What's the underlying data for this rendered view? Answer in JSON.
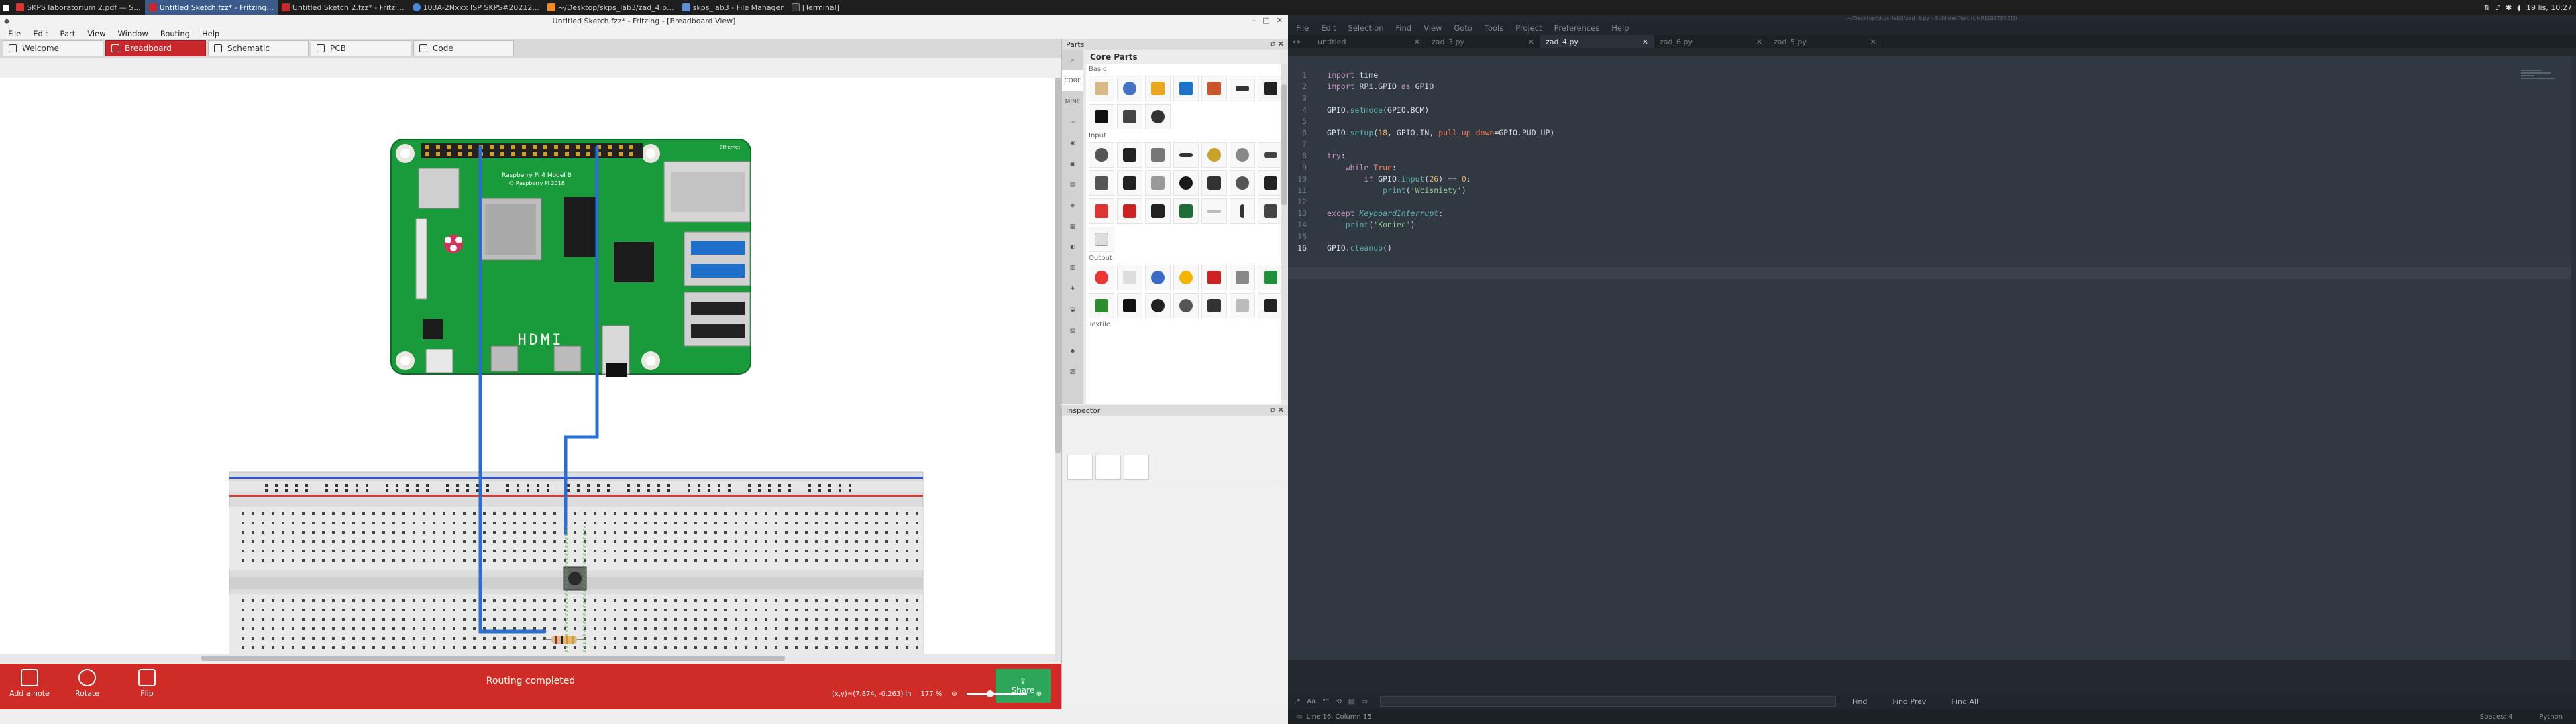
{
  "taskbar": {
    "tasks": [
      {
        "label": "SKPS laboratorium 2.pdf — S..."
      },
      {
        "label": "Untitled Sketch.fzz* - Fritzing..."
      },
      {
        "label": "Untitled Sketch 2.fzz* - Fritzi..."
      },
      {
        "label": "103A-2Nxxx ISP SKPS#20212..."
      },
      {
        "label": "~/Desktop/skps_lab3/zad_4.p..."
      },
      {
        "label": "skps_lab3 - File Manager"
      },
      {
        "label": "[Terminal]"
      }
    ],
    "clock": "19 lis, 10:27"
  },
  "fritzing": {
    "title": "Untitled Sketch.fzz* - Fritzing - [Breadboard View]",
    "menu": [
      "File",
      "Edit",
      "Part",
      "View",
      "Window",
      "Routing",
      "Help"
    ],
    "tabs": [
      "Welcome",
      "Breadboard",
      "Schematic",
      "PCB",
      "Code"
    ],
    "logo": "fritzing",
    "board": {
      "model_line1": "Raspberry Pi 4 Model B",
      "model_line2": "© Raspberry Pi 2018",
      "hdmi": "HDMI",
      "ethernet": "Ethernet"
    },
    "toolbar": {
      "add_note": "Add a note",
      "rotate": "Rotate",
      "flip": "Flip",
      "share": "Share",
      "status": "Routing completed",
      "coords": "(x,y)=(7.874, -0.263) in",
      "zoom": "177 %"
    },
    "parts": {
      "title": "Parts",
      "heading": "Core Parts",
      "bins": [
        "CORE",
        "MINE",
        "",
        "",
        "",
        "",
        "",
        "",
        "",
        "",
        "",
        "",
        "",
        "",
        "",
        ""
      ],
      "sections": [
        "Basic",
        "Input",
        "Output",
        "Textile"
      ]
    },
    "inspector": {
      "title": "Inspector"
    }
  },
  "sublime": {
    "title": "~/Desktop/skps_lab3/zad_4.py - Sublime Text (UNREGISTERED)",
    "menu": [
      "File",
      "Edit",
      "Selection",
      "Find",
      "View",
      "Goto",
      "Tools",
      "Project",
      "Preferences",
      "Help"
    ],
    "tabs": [
      "untitled",
      "zad_3.py",
      "zad_4.py",
      "zad_6.py",
      "zad_5.py"
    ],
    "line_numbers": [
      "1",
      "2",
      "3",
      "4",
      "5",
      "6",
      "7",
      "8",
      "9",
      "10",
      "11",
      "12",
      "13",
      "14",
      "15",
      "16"
    ],
    "find_buttons": [
      "Find",
      "Find Prev",
      "Find All"
    ],
    "status_left": "Line 16, Column 15",
    "status_spaces": "Spaces: 4",
    "status_syntax": "Python"
  },
  "colors": {
    "fritzing_accent": "#cf2b27",
    "share": "#2ea65a",
    "sublime_bg": "#303841"
  }
}
